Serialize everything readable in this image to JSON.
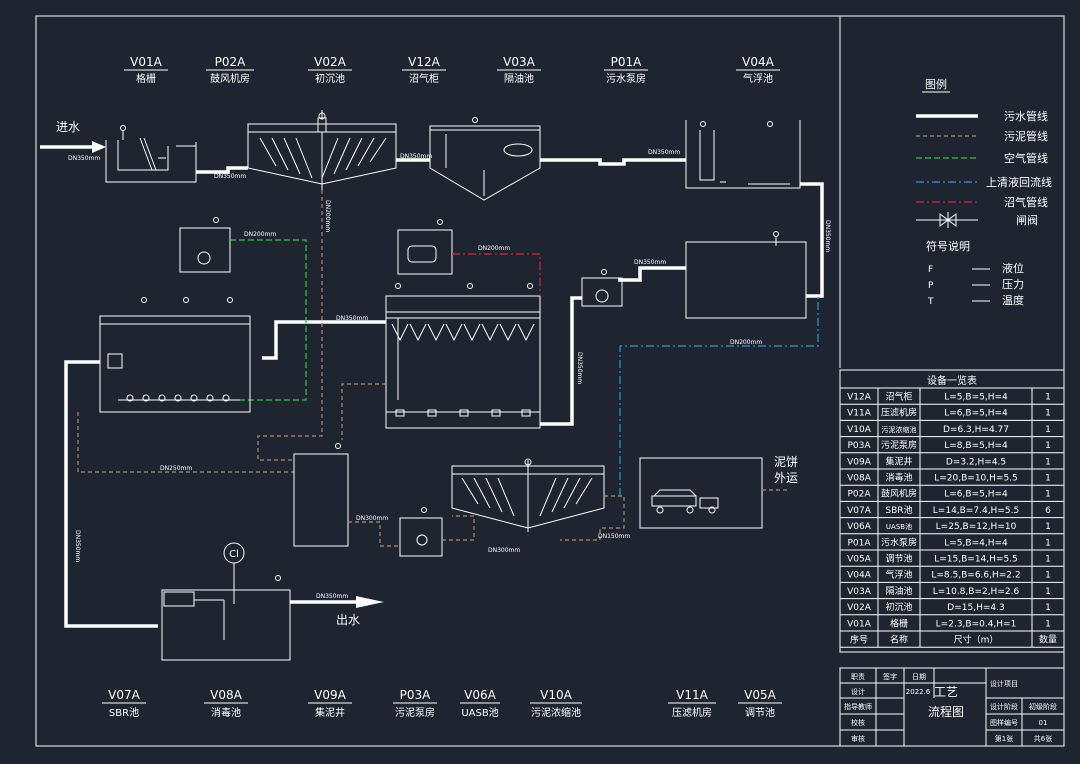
{
  "inlet_label": "进水",
  "outlet_label": "出水",
  "cake_label_1": "泥饼",
  "cake_label_2": "外运",
  "disinfect_symbol": "Cl",
  "top_units": [
    {
      "code": "V01A",
      "name": "格栅"
    },
    {
      "code": "P02A",
      "name": "鼓风机房"
    },
    {
      "code": "V02A",
      "name": "初沉池"
    },
    {
      "code": "V12A",
      "name": "沼气柜"
    },
    {
      "code": "V03A",
      "name": "隔油池"
    },
    {
      "code": "P01A",
      "name": "污水泵房"
    },
    {
      "code": "V04A",
      "name": "气浮池"
    }
  ],
  "bottom_units": [
    {
      "code": "V07A",
      "name": "SBR池"
    },
    {
      "code": "V08A",
      "name": "消毒池"
    },
    {
      "code": "V09A",
      "name": "集泥井"
    },
    {
      "code": "P03A",
      "name": "污泥泵房"
    },
    {
      "code": "V06A",
      "name": "UASB池"
    },
    {
      "code": "V10A",
      "name": "污泥浓缩池"
    },
    {
      "code": "V11A",
      "name": "压滤机房"
    },
    {
      "code": "V05A",
      "name": "调节池"
    }
  ],
  "pipe_labels": {
    "p1": "DN350mm",
    "p2": "DN350mm",
    "p3": "DN350mm",
    "p4": "DN350mm",
    "p5": "DN350mm",
    "p6": "DN200mm",
    "p7": "DN200mm",
    "p8": "DN200mm",
    "p9": "DN350mm",
    "p10": "DN350mm",
    "p11": "DN350mm",
    "p12": "DN200mm",
    "p13": "DN250mm",
    "p14": "DN300mm",
    "p15": "DN300mm",
    "p16": "DN150mm",
    "p17": "DN350mm",
    "p18": "DN350mm"
  },
  "legend": {
    "title": "图例",
    "items": [
      {
        "label": "污水管线",
        "color": "#ffffff"
      },
      {
        "label": "污泥管线",
        "color": "#b58b5f"
      },
      {
        "label": "空气管线",
        "color": "#27c93f"
      },
      {
        "label": "上清液回流线",
        "color": "#2a9ad6"
      },
      {
        "label": "沼气管线",
        "color": "#d6292c"
      },
      {
        "label": "闸阀",
        "color": "#ffffff"
      }
    ],
    "symbols_title": "符号说明",
    "symbols": [
      {
        "sym": "F",
        "desc": "液位"
      },
      {
        "sym": "P",
        "desc": "压力"
      },
      {
        "sym": "T",
        "desc": "温度"
      }
    ]
  },
  "equipment_table": {
    "title": "设备一览表",
    "rows": [
      {
        "code": "V12A",
        "name": "沼气柜",
        "size": "L=5,B=5,H=4",
        "qty": "1"
      },
      {
        "code": "V11A",
        "name": "压滤机房",
        "size": "L=6,B=5,H=4",
        "qty": "1"
      },
      {
        "code": "V10A",
        "name": "污泥浓缩池",
        "size": "D=6.3,H=4.77",
        "qty": "1"
      },
      {
        "code": "P03A",
        "name": "污泥泵房",
        "size": "L=8,B=5,H=4",
        "qty": "1"
      },
      {
        "code": "V09A",
        "name": "集泥井",
        "size": "D=3.2,H=4.5",
        "qty": "1"
      },
      {
        "code": "V08A",
        "name": "消毒池",
        "size": "L=20,B=10,H=5.5",
        "qty": "1"
      },
      {
        "code": "P02A",
        "name": "鼓风机房",
        "size": "L=6,B=5,H=4",
        "qty": "1"
      },
      {
        "code": "V07A",
        "name": "SBR池",
        "size": "L=14,B=7.4,H=5.5",
        "qty": "6"
      },
      {
        "code": "V06A",
        "name": "UASB池",
        "size": "L=25,B=12,H=10",
        "qty": "1"
      },
      {
        "code": "P01A",
        "name": "污水泵房",
        "size": "L=5,B=4,H=4",
        "qty": "1"
      },
      {
        "code": "V05A",
        "name": "调节池",
        "size": "L=15,B=14,H=5.5",
        "qty": "1"
      },
      {
        "code": "V04A",
        "name": "气浮池",
        "size": "L=8.5,B=6.6,H=2.2",
        "qty": "1"
      },
      {
        "code": "V03A",
        "name": "隔油池",
        "size": "L=10.8,B=2,H=2.6",
        "qty": "1"
      },
      {
        "code": "V02A",
        "name": "初沉池",
        "size": "D=15,H=4.3",
        "qty": "1"
      },
      {
        "code": "V01A",
        "name": "格栅",
        "size": "L=2.3,B=0.4,H=1",
        "qty": "1"
      }
    ],
    "header": {
      "code": "序号",
      "name": "名称",
      "size": "尺寸（m）",
      "qty": "数量"
    }
  },
  "title_block": {
    "r1c1": "职责",
    "r1c2": "签字",
    "r1c3": "日期",
    "r2c1": "设计",
    "date": "2022.6",
    "r3c1": "指导教师",
    "r4c1": "校核",
    "r5c1": "审核",
    "drawing_title_1": "工艺",
    "drawing_title_2": "流程图",
    "proj_label": "设计项目",
    "stage_label": "设计阶段",
    "stage_value": "初级阶段",
    "no_label": "图样编号",
    "no_value": "01",
    "sheet": "第1张",
    "total": "共6张"
  }
}
